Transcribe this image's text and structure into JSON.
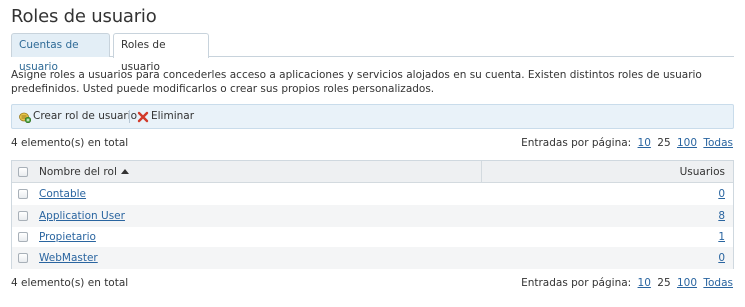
{
  "page": {
    "title": "Roles de usuario"
  },
  "tabs": [
    {
      "label": "Cuentas de usuario",
      "active": false
    },
    {
      "label": "Roles de usuario",
      "active": true
    }
  ],
  "description": "Asigne roles a usuarios para concederles acceso a aplicaciones y servicios alojados en su cuenta. Existen distintos roles de usuario predefinidos. Usted puede modificarlos o crear sus propios roles personalizados.",
  "toolbar": {
    "create_label": "Crear rol de usuario",
    "create_icon": "add-role-icon",
    "delete_label": "Eliminar",
    "delete_icon": "delete-x-icon"
  },
  "summary": {
    "total_text": "4 elemento(s) en total"
  },
  "pager": {
    "label": "Entradas por página:",
    "options": [
      "10",
      "25",
      "100",
      "Todas"
    ],
    "current": "25"
  },
  "table": {
    "columns": {
      "name": "Nombre del rol",
      "users": "Usuarios"
    },
    "sort": "ascending",
    "rows": [
      {
        "name": "Contable",
        "users": "0"
      },
      {
        "name": "Application User",
        "users": "8"
      },
      {
        "name": "Propietario",
        "users": "1"
      },
      {
        "name": "WebMaster",
        "users": "0"
      }
    ]
  },
  "colors": {
    "link": "#2a65a0",
    "toolbar_bg": "#e9f2f9",
    "tab_inactive_bg": "#e3eef6",
    "header_bg": "#eef0f2"
  }
}
